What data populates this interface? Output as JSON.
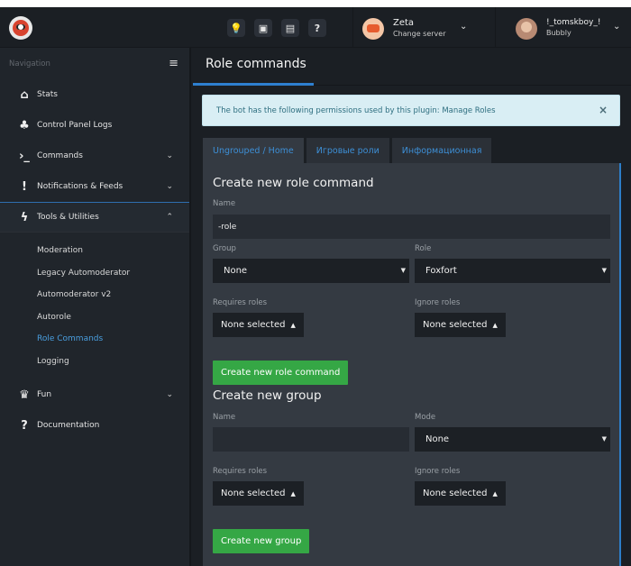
{
  "topbar": {
    "icons": [
      "lightbulb-icon",
      "discord-icon",
      "id-card-icon",
      "question-icon"
    ],
    "icon_glyphs": [
      "💡",
      "▣",
      "▤",
      "?"
    ],
    "server": {
      "name": "Zeta",
      "action": "Change server"
    },
    "user": {
      "name": "!_tomskboy_!",
      "nickname": "Bubbly"
    }
  },
  "sidebar": {
    "header": "Navigation",
    "items": [
      {
        "label": "Stats",
        "icon": "home-icon",
        "glyph": "⌂",
        "expandable": false
      },
      {
        "label": "Control Panel Logs",
        "icon": "tree-icon",
        "glyph": "♣",
        "expandable": false
      },
      {
        "label": "Commands",
        "icon": "terminal-icon",
        "glyph": "›_",
        "expandable": true
      },
      {
        "label": "Notifications & Feeds",
        "icon": "exclamation-icon",
        "glyph": "!",
        "expandable": true
      },
      {
        "label": "Tools & Utilities",
        "icon": "bolt-icon",
        "glyph": "ϟ",
        "expandable": true,
        "expanded": true
      }
    ],
    "submenu": [
      "Moderation",
      "Legacy Automoderator",
      "Automoderator v2",
      "Autorole",
      "Role Commands",
      "Logging"
    ],
    "current_submenu": "Role Commands",
    "items_after": [
      {
        "label": "Fun",
        "icon": "trophy-icon",
        "glyph": "♛",
        "expandable": true
      },
      {
        "label": "Documentation",
        "icon": "question-icon",
        "glyph": "?",
        "expandable": false
      }
    ]
  },
  "main": {
    "title": "Role commands",
    "alert": "The bot has the following permissions used by this plugin: Manage Roles",
    "alert_close": "×",
    "tabs": [
      "Ungrouped / Home",
      "Игровые роли",
      "Информационная"
    ],
    "active_tab": "Ungrouped / Home",
    "create_command": {
      "heading": "Create new role command",
      "name_label": "Name",
      "name_value": "-role",
      "group_label": "Group",
      "group_value": "None",
      "role_label": "Role",
      "role_value": "Foxfort",
      "requires_label": "Requires roles",
      "requires_value": "None selected",
      "ignore_label": "Ignore roles",
      "ignore_value": "None selected",
      "button": "Create new role command"
    },
    "create_group": {
      "heading": "Create new group",
      "name_label": "Name",
      "name_value": "",
      "mode_label": "Mode",
      "mode_value": "None",
      "requires_label": "Requires roles",
      "requires_value": "None selected",
      "ignore_label": "Ignore roles",
      "ignore_value": "None selected",
      "button": "Create new group"
    }
  },
  "colors": {
    "accent": "#2e7fd0",
    "success_button": "#35a745",
    "alert_bg": "#d9eef4",
    "sidebar_bg": "#20252b",
    "panel_bg": "#343a42"
  }
}
